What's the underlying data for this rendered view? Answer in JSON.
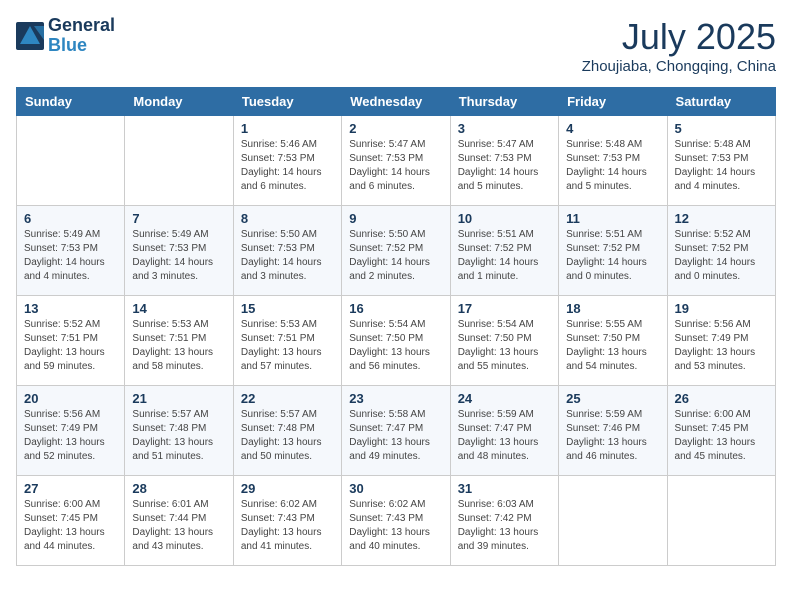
{
  "header": {
    "logo_line1": "General",
    "logo_line2": "Blue",
    "month_year": "July 2025",
    "location": "Zhoujiaba, Chongqing, China"
  },
  "weekdays": [
    "Sunday",
    "Monday",
    "Tuesday",
    "Wednesday",
    "Thursday",
    "Friday",
    "Saturday"
  ],
  "weeks": [
    [
      {
        "day": "",
        "info": ""
      },
      {
        "day": "",
        "info": ""
      },
      {
        "day": "1",
        "info": "Sunrise: 5:46 AM\nSunset: 7:53 PM\nDaylight: 14 hours and 6 minutes."
      },
      {
        "day": "2",
        "info": "Sunrise: 5:47 AM\nSunset: 7:53 PM\nDaylight: 14 hours and 6 minutes."
      },
      {
        "day": "3",
        "info": "Sunrise: 5:47 AM\nSunset: 7:53 PM\nDaylight: 14 hours and 5 minutes."
      },
      {
        "day": "4",
        "info": "Sunrise: 5:48 AM\nSunset: 7:53 PM\nDaylight: 14 hours and 5 minutes."
      },
      {
        "day": "5",
        "info": "Sunrise: 5:48 AM\nSunset: 7:53 PM\nDaylight: 14 hours and 4 minutes."
      }
    ],
    [
      {
        "day": "6",
        "info": "Sunrise: 5:49 AM\nSunset: 7:53 PM\nDaylight: 14 hours and 4 minutes."
      },
      {
        "day": "7",
        "info": "Sunrise: 5:49 AM\nSunset: 7:53 PM\nDaylight: 14 hours and 3 minutes."
      },
      {
        "day": "8",
        "info": "Sunrise: 5:50 AM\nSunset: 7:53 PM\nDaylight: 14 hours and 3 minutes."
      },
      {
        "day": "9",
        "info": "Sunrise: 5:50 AM\nSunset: 7:52 PM\nDaylight: 14 hours and 2 minutes."
      },
      {
        "day": "10",
        "info": "Sunrise: 5:51 AM\nSunset: 7:52 PM\nDaylight: 14 hours and 1 minute."
      },
      {
        "day": "11",
        "info": "Sunrise: 5:51 AM\nSunset: 7:52 PM\nDaylight: 14 hours and 0 minutes."
      },
      {
        "day": "12",
        "info": "Sunrise: 5:52 AM\nSunset: 7:52 PM\nDaylight: 14 hours and 0 minutes."
      }
    ],
    [
      {
        "day": "13",
        "info": "Sunrise: 5:52 AM\nSunset: 7:51 PM\nDaylight: 13 hours and 59 minutes."
      },
      {
        "day": "14",
        "info": "Sunrise: 5:53 AM\nSunset: 7:51 PM\nDaylight: 13 hours and 58 minutes."
      },
      {
        "day": "15",
        "info": "Sunrise: 5:53 AM\nSunset: 7:51 PM\nDaylight: 13 hours and 57 minutes."
      },
      {
        "day": "16",
        "info": "Sunrise: 5:54 AM\nSunset: 7:50 PM\nDaylight: 13 hours and 56 minutes."
      },
      {
        "day": "17",
        "info": "Sunrise: 5:54 AM\nSunset: 7:50 PM\nDaylight: 13 hours and 55 minutes."
      },
      {
        "day": "18",
        "info": "Sunrise: 5:55 AM\nSunset: 7:50 PM\nDaylight: 13 hours and 54 minutes."
      },
      {
        "day": "19",
        "info": "Sunrise: 5:56 AM\nSunset: 7:49 PM\nDaylight: 13 hours and 53 minutes."
      }
    ],
    [
      {
        "day": "20",
        "info": "Sunrise: 5:56 AM\nSunset: 7:49 PM\nDaylight: 13 hours and 52 minutes."
      },
      {
        "day": "21",
        "info": "Sunrise: 5:57 AM\nSunset: 7:48 PM\nDaylight: 13 hours and 51 minutes."
      },
      {
        "day": "22",
        "info": "Sunrise: 5:57 AM\nSunset: 7:48 PM\nDaylight: 13 hours and 50 minutes."
      },
      {
        "day": "23",
        "info": "Sunrise: 5:58 AM\nSunset: 7:47 PM\nDaylight: 13 hours and 49 minutes."
      },
      {
        "day": "24",
        "info": "Sunrise: 5:59 AM\nSunset: 7:47 PM\nDaylight: 13 hours and 48 minutes."
      },
      {
        "day": "25",
        "info": "Sunrise: 5:59 AM\nSunset: 7:46 PM\nDaylight: 13 hours and 46 minutes."
      },
      {
        "day": "26",
        "info": "Sunrise: 6:00 AM\nSunset: 7:45 PM\nDaylight: 13 hours and 45 minutes."
      }
    ],
    [
      {
        "day": "27",
        "info": "Sunrise: 6:00 AM\nSunset: 7:45 PM\nDaylight: 13 hours and 44 minutes."
      },
      {
        "day": "28",
        "info": "Sunrise: 6:01 AM\nSunset: 7:44 PM\nDaylight: 13 hours and 43 minutes."
      },
      {
        "day": "29",
        "info": "Sunrise: 6:02 AM\nSunset: 7:43 PM\nDaylight: 13 hours and 41 minutes."
      },
      {
        "day": "30",
        "info": "Sunrise: 6:02 AM\nSunset: 7:43 PM\nDaylight: 13 hours and 40 minutes."
      },
      {
        "day": "31",
        "info": "Sunrise: 6:03 AM\nSunset: 7:42 PM\nDaylight: 13 hours and 39 minutes."
      },
      {
        "day": "",
        "info": ""
      },
      {
        "day": "",
        "info": ""
      }
    ]
  ]
}
